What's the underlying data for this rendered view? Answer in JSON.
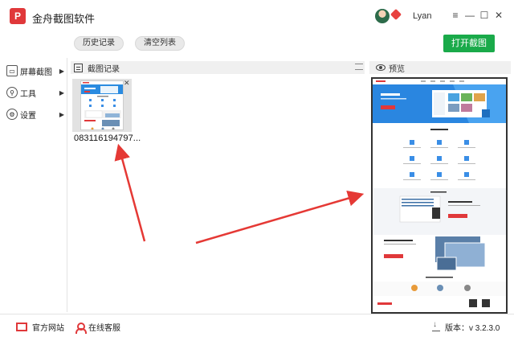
{
  "app": {
    "title": "金舟截图软件",
    "logo_text": "P"
  },
  "user": {
    "name": "Lyan"
  },
  "window_controls": [
    "≡",
    "—",
    "☐",
    "✕"
  ],
  "toolbar": {
    "history_label": "历史记录",
    "clear_label": "清空列表",
    "open_label": "打开截图"
  },
  "sidebar": {
    "items": [
      {
        "label": "屏幕截图",
        "icon": "screenshot-icon"
      },
      {
        "label": "工具",
        "icon": "tool-icon"
      },
      {
        "label": "设置",
        "icon": "gear-icon"
      }
    ]
  },
  "list_panel": {
    "title": "截图记录",
    "thumbnail": {
      "filename": "083116194797..."
    }
  },
  "preview_panel": {
    "title": "预览"
  },
  "footer": {
    "website_label": "官方网站",
    "service_label": "在线客服",
    "version_label": "版本：v 3.2.3.0"
  },
  "colors": {
    "accent": "#e0383a",
    "primary_button": "#1aaa4a",
    "arrow": "#e53935"
  }
}
